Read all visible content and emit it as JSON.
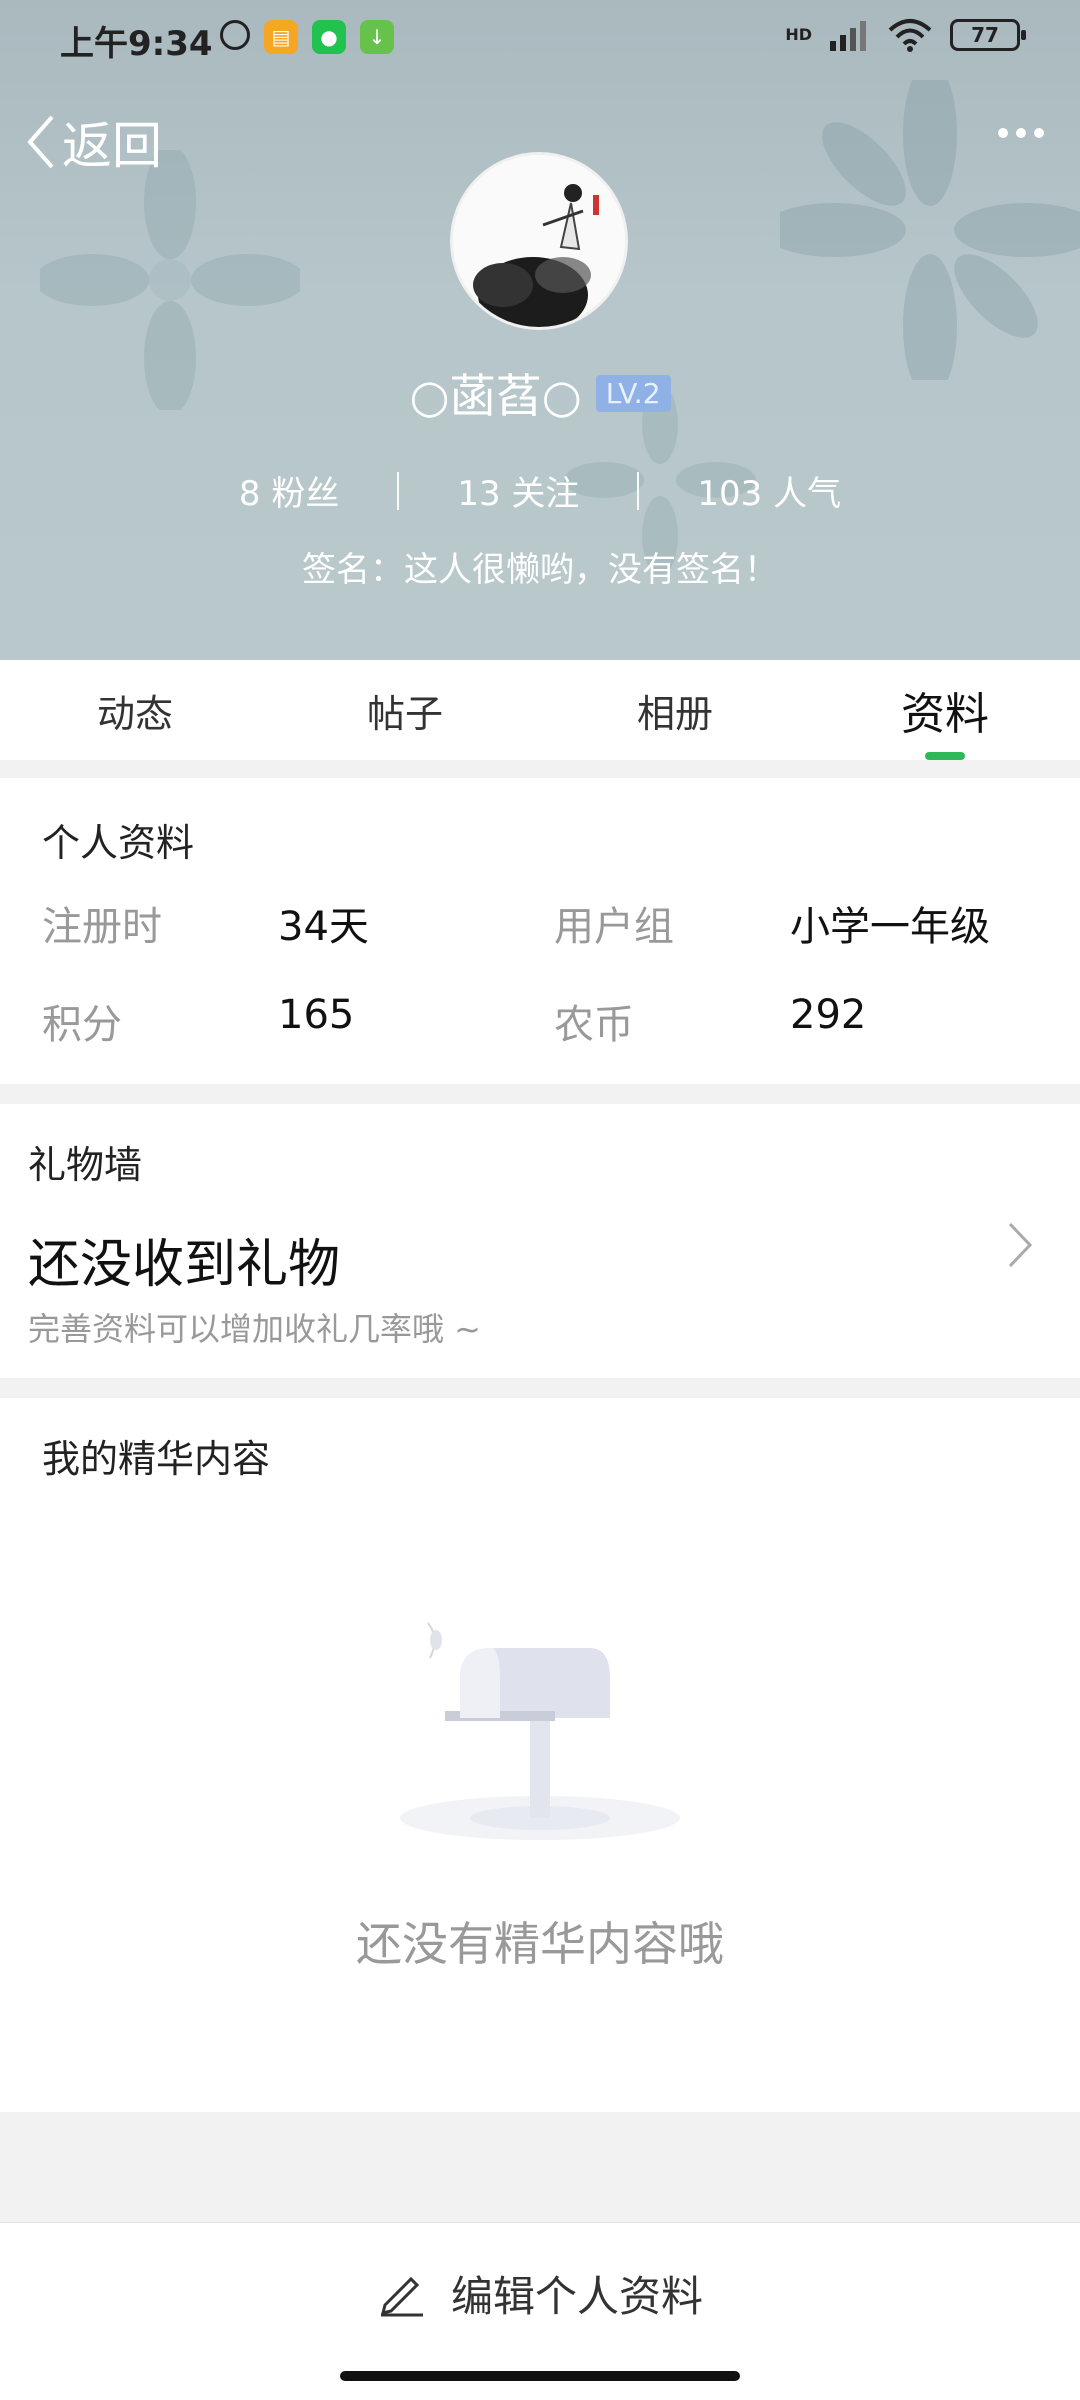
{
  "status": {
    "time": "上午9:34",
    "battery": "77",
    "network": "HD"
  },
  "nav": {
    "back_label": "返回"
  },
  "profile": {
    "username": "○菡萏○",
    "level": "LV.2",
    "stats": [
      "8 粉丝",
      "13 关注",
      "103 人气"
    ],
    "signature": "签名：这人很懒哟，没有签名！"
  },
  "tabs": [
    "动态",
    "帖子",
    "相册",
    "资料"
  ],
  "personal_info": {
    "title": "个人资料",
    "rows": [
      {
        "k1": "注册时",
        "v1": "34天",
        "k2": "用户组",
        "v2": "小学一年级"
      },
      {
        "k1": "积分",
        "v1": "165",
        "k2": "农币",
        "v2": "292"
      }
    ]
  },
  "gift_wall": {
    "title": "礼物墙",
    "main": "还没收到礼物",
    "sub": "完善资料可以增加收礼几率哦 ~"
  },
  "featured": {
    "title": "我的精华内容",
    "empty_text": "还没有精华内容哦"
  },
  "bottom": {
    "edit_label": "编辑个人资料"
  },
  "colors": {
    "accent": "#2fb85a",
    "level_badge": "#8fb1e6",
    "hero_bg": "#b4c4c8"
  }
}
